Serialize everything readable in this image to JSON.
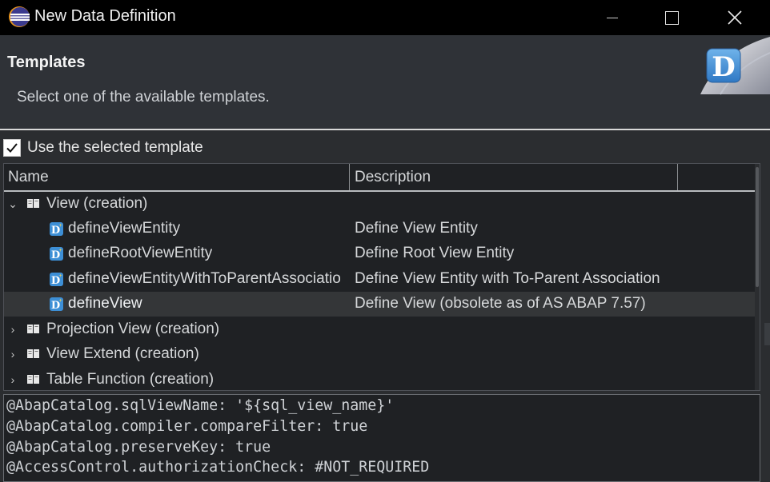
{
  "window": {
    "title": "New Data Definition",
    "icon": "eclipse-icon",
    "controls": [
      "minimize",
      "maximize",
      "close"
    ]
  },
  "header": {
    "title": "Templates",
    "description": "Select one of the available templates.",
    "banner_icon": "data-definition-icon",
    "banner_letter": "D"
  },
  "use_template": {
    "label": "Use the selected template",
    "checked": true
  },
  "tree": {
    "columns": [
      "Name",
      "Description"
    ],
    "rows": [
      {
        "type": "group",
        "expanded": true,
        "name": "View (creation)",
        "description": ""
      },
      {
        "type": "template",
        "name": "defineViewEntity",
        "description": "Define View Entity"
      },
      {
        "type": "template",
        "name": "defineRootViewEntity",
        "description": "Define Root View Entity"
      },
      {
        "type": "template",
        "name": "defineViewEntityWithToParentAssociatio",
        "description": "Define View Entity with To-Parent Association"
      },
      {
        "type": "template",
        "name": "defineView",
        "description": "Define View (obsolete as of AS ABAP 7.57)",
        "selected": true
      },
      {
        "type": "group",
        "expanded": false,
        "name": "Projection View (creation)",
        "description": ""
      },
      {
        "type": "group",
        "expanded": false,
        "name": "View Extend (creation)",
        "description": ""
      },
      {
        "type": "group",
        "expanded": false,
        "name": "Table Function (creation)",
        "description": ""
      }
    ]
  },
  "preview": {
    "lines": [
      "@AbapCatalog.sqlViewName: '${sql_view_name}'",
      "@AbapCatalog.compiler.compareFilter: true",
      "@AbapCatalog.preserveKey: true",
      "@AccessControl.authorizationCheck: #NOT_REQUIRED"
    ]
  },
  "colors": {
    "titlebar": "#000000",
    "header_bg": "#2f3237",
    "tree_bg": "#1f2124",
    "selected_row": "#343638",
    "icon_blue": "#3d8fd6"
  }
}
